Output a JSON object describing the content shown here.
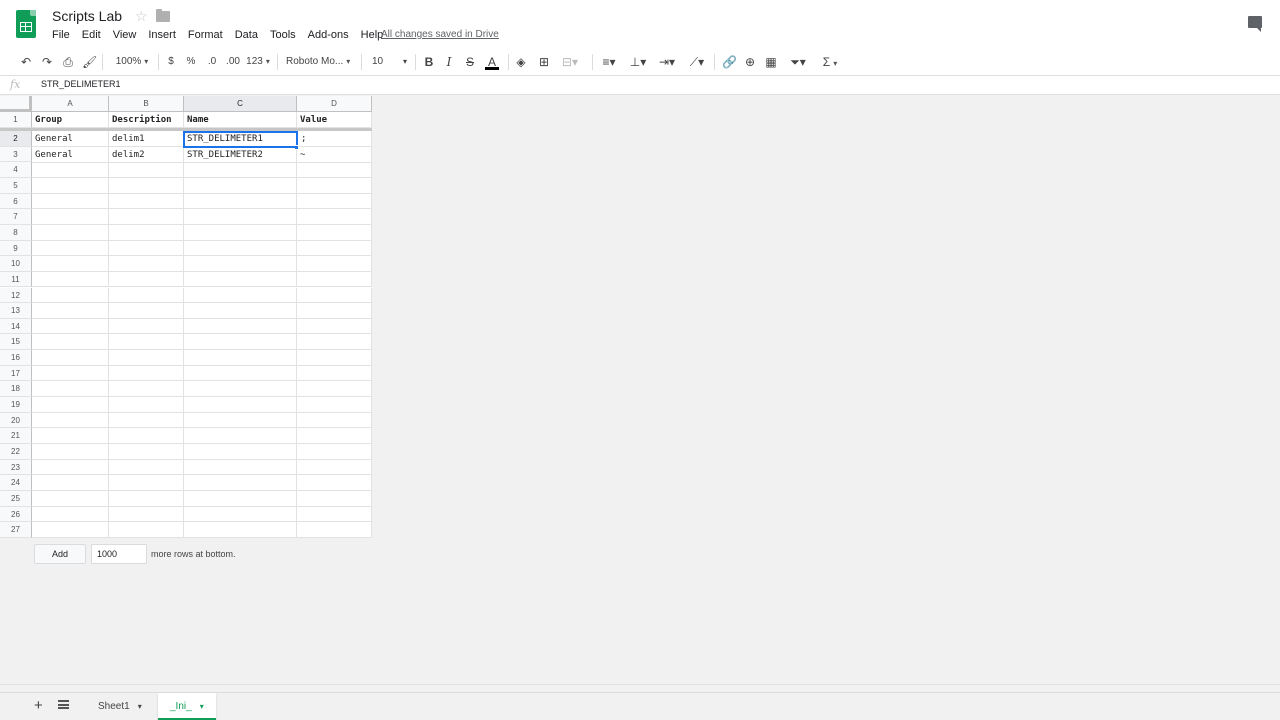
{
  "app": {
    "title": "Scripts Lab",
    "save_status": "All changes saved in Drive",
    "menu": [
      "File",
      "Edit",
      "View",
      "Insert",
      "Format",
      "Data",
      "Tools",
      "Add-ons",
      "Help"
    ]
  },
  "toolbar": {
    "zoom": "100%",
    "currency": "$",
    "percent": "%",
    "decrease_decimal": ".0",
    "increase_decimal": ".00",
    "more_formats": "123",
    "font": "Roboto Mo...",
    "font_size": "10",
    "bold": "B",
    "italic": "I",
    "strike": "S",
    "text_color": "A",
    "functions": "Σ"
  },
  "formula_bar": {
    "fx": "fx",
    "value": "STR_DELIMETER1"
  },
  "grid": {
    "columns": [
      "A",
      "B",
      "C",
      "D"
    ],
    "rows": [
      "1",
      "2",
      "3",
      "4",
      "5",
      "6",
      "7",
      "8",
      "9",
      "10",
      "11",
      "12",
      "13",
      "14",
      "15",
      "16",
      "17",
      "18",
      "19",
      "20",
      "21",
      "22",
      "23",
      "24",
      "25",
      "26",
      "27"
    ],
    "cells": [
      [
        "Group",
        "Description",
        "Name",
        "Value"
      ],
      [
        "General",
        "delim1",
        "STR_DELIMETER1",
        ";"
      ],
      [
        "General",
        "delim2",
        "STR_DELIMETER2",
        "~"
      ]
    ],
    "selected": "C2"
  },
  "add_rows": {
    "button": "Add",
    "count": "1000",
    "label": "more rows at bottom."
  },
  "tabs": [
    {
      "label": "Sheet1",
      "active": false
    },
    {
      "label": "_Ini_",
      "active": true
    }
  ],
  "colors": {
    "accent": "#1a73e8",
    "brand": "#0f9d58"
  }
}
